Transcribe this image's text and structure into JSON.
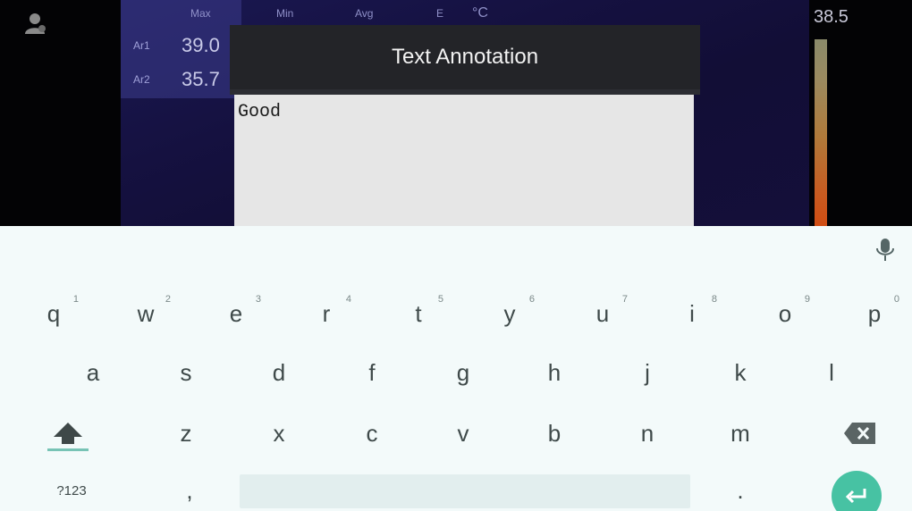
{
  "measurement": {
    "columns": [
      "Max",
      "Min",
      "Avg",
      "E",
      "°C"
    ],
    "rows": [
      {
        "label": "Ar1",
        "max": "39.0"
      },
      {
        "label": "Ar2",
        "max": "35.7"
      }
    ]
  },
  "scale": {
    "max": "38.5"
  },
  "dialog": {
    "title": "Text Annotation",
    "value": "Good"
  },
  "keyboard": {
    "row1": [
      {
        "key": "q",
        "hint": "1"
      },
      {
        "key": "w",
        "hint": "2"
      },
      {
        "key": "e",
        "hint": "3"
      },
      {
        "key": "r",
        "hint": "4"
      },
      {
        "key": "t",
        "hint": "5"
      },
      {
        "key": "y",
        "hint": "6"
      },
      {
        "key": "u",
        "hint": "7"
      },
      {
        "key": "i",
        "hint": "8"
      },
      {
        "key": "o",
        "hint": "9"
      },
      {
        "key": "p",
        "hint": "0"
      }
    ],
    "row2": [
      "a",
      "s",
      "d",
      "f",
      "g",
      "h",
      "j",
      "k",
      "l"
    ],
    "row3": [
      "z",
      "x",
      "c",
      "v",
      "b",
      "n",
      "m"
    ],
    "symbols_label": "?123",
    "comma_label": ",",
    "period_label": "."
  },
  "colors": {
    "enter_key": "#47c2a3",
    "dialog_header": "#232428",
    "keyboard_bg": "#f3fafa"
  }
}
